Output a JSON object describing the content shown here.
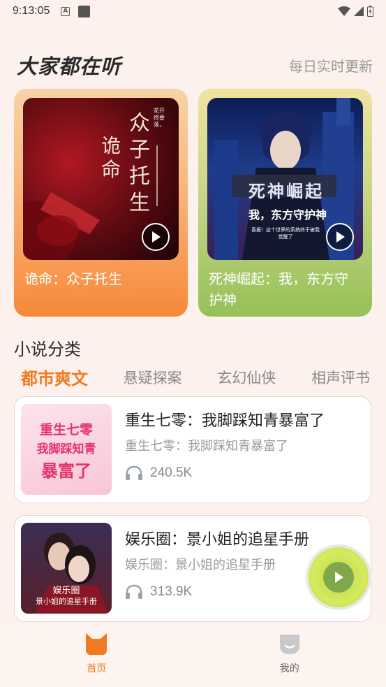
{
  "status_bar": {
    "time": "9:13:05"
  },
  "featured": {
    "title": "大家都在听",
    "subtitle": "每日实时更新",
    "cards": [
      {
        "title": "诡命：众子托生",
        "cover_text_a": "诡命",
        "cover_text_b": "众子托生",
        "cover_small": "花开  终要落，"
      },
      {
        "title": "死神崛起：我，东方守护神",
        "cover_text_a": "死神崛起",
        "cover_text_b": "我，东方守护神",
        "cover_small": "喜报！这个世界的系统终于被我觉醒了"
      }
    ]
  },
  "categories": {
    "title": "小说分类",
    "tabs": [
      {
        "label": "都市爽文",
        "active": true
      },
      {
        "label": "悬疑探案",
        "active": false
      },
      {
        "label": "玄幻仙侠",
        "active": false
      },
      {
        "label": "相声评书",
        "active": false
      }
    ]
  },
  "books": [
    {
      "title": "重生七零：我脚踩知青暴富了",
      "subtitle": "重生七零：我脚踩知青暴富了",
      "plays": "240.5K",
      "cover_l1": "重生七零",
      "cover_l2": "我脚踩知青",
      "cover_l3": "暴富了"
    },
    {
      "title": "娱乐圈：景小姐的追星手册",
      "subtitle": "娱乐圈：景小姐的追星手册",
      "plays": "313.9K",
      "cover_l1": "娱乐圈",
      "cover_l2": "景小姐的追星手册"
    }
  ],
  "nav": {
    "home": "首页",
    "mine": "我的"
  },
  "colors": {
    "accent": "#f07a21",
    "background": "#fcf1ec"
  }
}
